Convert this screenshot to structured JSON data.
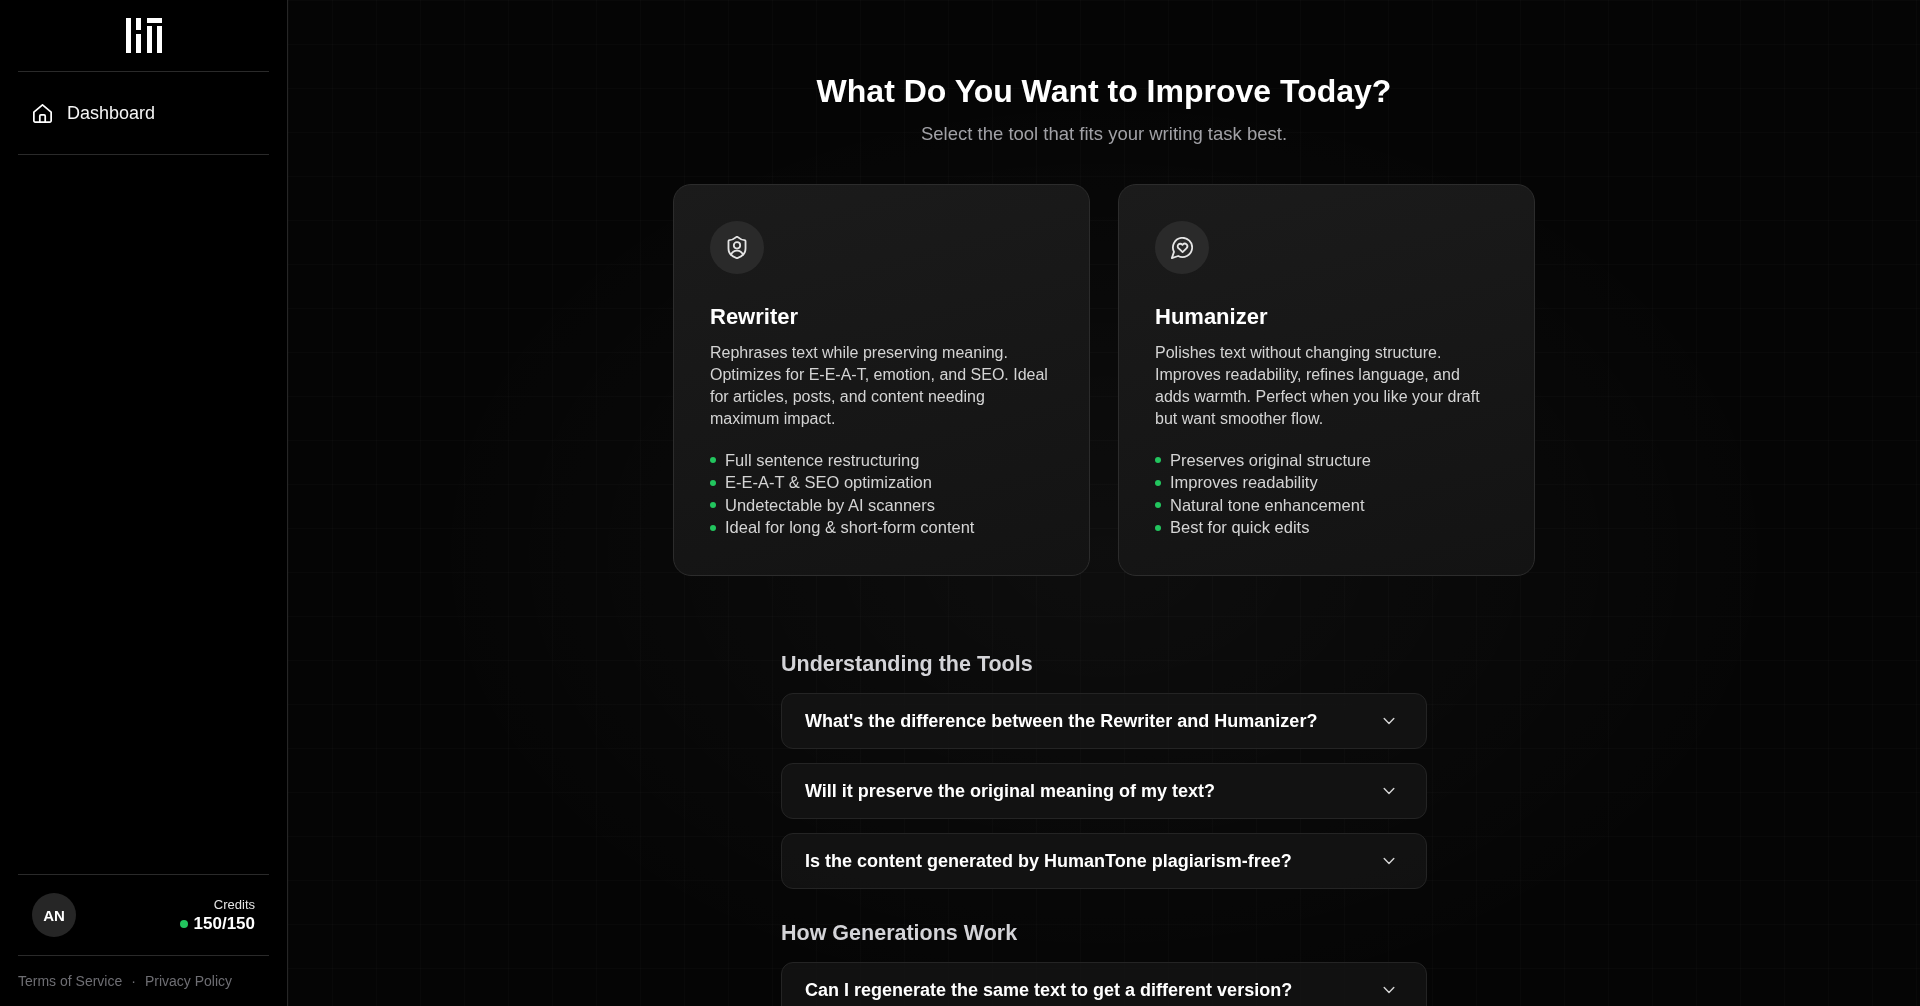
{
  "sidebar": {
    "nav": [
      {
        "label": "Dashboard"
      }
    ],
    "account": {
      "initials": "AN",
      "credits_label": "Credits",
      "credits": "150/150"
    },
    "footer": {
      "links": [
        "Terms of Service",
        "Privacy Policy"
      ],
      "separator": "·"
    }
  },
  "header": {
    "title": "What Do You Want to Improve Today?",
    "subtitle": "Select the tool that fits your writing task best."
  },
  "tools": [
    {
      "name": "Rewriter",
      "description": "Rephrases text while preserving meaning. Optimizes for E-E-A-T, emotion, and SEO. Ideal for articles, posts, and content needing maximum impact.",
      "features": [
        "Full sentence restructuring",
        "E-E-A-T & SEO optimization",
        "Undetectable by AI scanners",
        "Ideal for long & short-form content"
      ]
    },
    {
      "name": "Humanizer",
      "description": "Polishes text without changing structure. Improves readability, refines language, and adds warmth. Perfect when you like your draft but want smoother flow.",
      "features": [
        "Preserves original structure",
        "Improves readability",
        "Natural tone enhancement",
        "Best for quick edits"
      ]
    }
  ],
  "faq_sections": [
    {
      "title": "Understanding the Tools",
      "items": [
        {
          "question": "What's the difference between the Rewriter and Humanizer?",
          "expanded": false
        },
        {
          "question": "Will it preserve the original meaning of my text?",
          "expanded": false
        },
        {
          "question": "Is the content generated by HumanTone plagiarism-free?",
          "expanded": false
        }
      ]
    },
    {
      "title": "How Generations Work",
      "items": [
        {
          "question": "Can I regenerate the same text to get a different version?",
          "expanded": false
        }
      ]
    }
  ]
}
